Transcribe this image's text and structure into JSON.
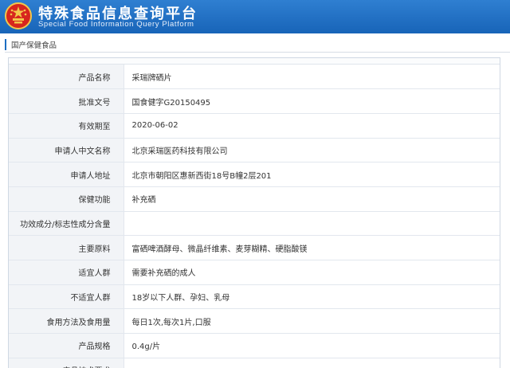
{
  "header": {
    "title": "特殊食品信息查询平台",
    "subtitle": "Special Food Information Query Platform",
    "colors": {
      "bar": "#1864b8",
      "emblem": "#d7261e"
    }
  },
  "section_tab": {
    "label": "国产保健食品"
  },
  "details": [
    {
      "label": "产品名称",
      "value": "采瑞牌硒片"
    },
    {
      "label": "批准文号",
      "value": "国食健字G20150495"
    },
    {
      "label": "有效期至",
      "value": "2020-06-02"
    },
    {
      "label": "申请人中文名称",
      "value": "北京采瑞医药科技有限公司"
    },
    {
      "label": "申请人地址",
      "value": "北京市朝阳区惠新西街18号B幢2层201"
    },
    {
      "label": "保健功能",
      "value": "补充硒"
    },
    {
      "label": "功效成分/标志性成分含量",
      "value": ""
    },
    {
      "label": "主要原料",
      "value": "富硒啤酒酵母、微晶纤维素、麦芽糊精、硬脂酸镁"
    },
    {
      "label": "适宜人群",
      "value": "需要补充硒的成人"
    },
    {
      "label": "不适宜人群",
      "value": "18岁以下人群、孕妇、乳母"
    },
    {
      "label": "食用方法及食用量",
      "value": "每日1次,每次1片,口服"
    },
    {
      "label": "产品规格",
      "value": "0.4g/片"
    },
    {
      "label": "产品技术要求",
      "value": ""
    }
  ]
}
